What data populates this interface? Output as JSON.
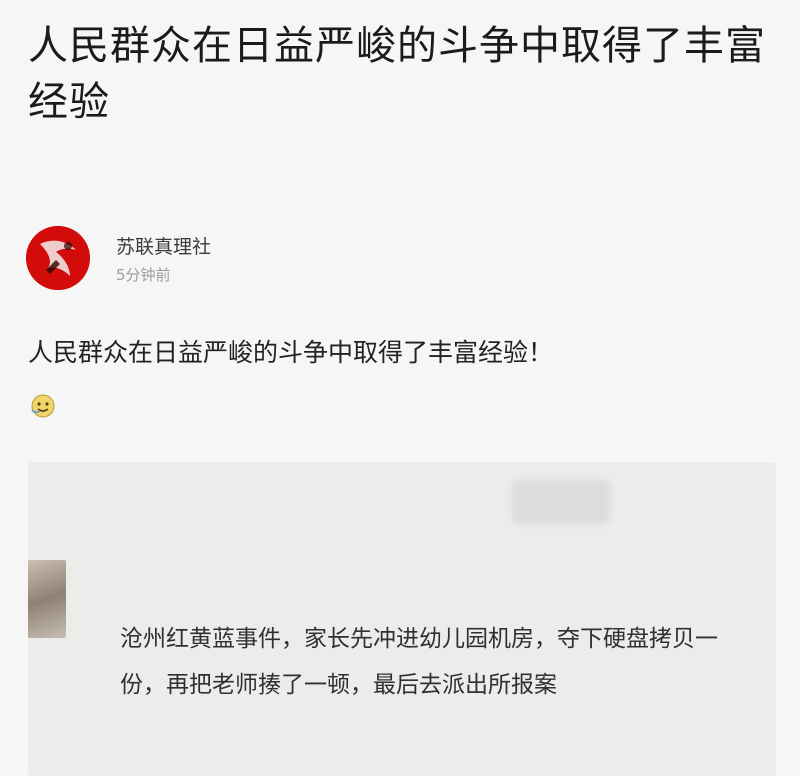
{
  "page": {
    "title": "人民群众在日益严峻的斗争中取得了丰富经验"
  },
  "post": {
    "author": "苏联真理社",
    "time": "5分钟前",
    "body": "人民群众在日益严峻的斗争中取得了丰富经验！"
  },
  "quoted": {
    "username": "​",
    "comment": "沧州红黄蓝事件，家长先冲进幼儿园机房，夺下硬盘拷贝一份，再把老师揍了一顿，最后去派出所报案"
  },
  "colors": {
    "avatar_bg": "#d20b0b",
    "card_bg": "#ececea"
  }
}
